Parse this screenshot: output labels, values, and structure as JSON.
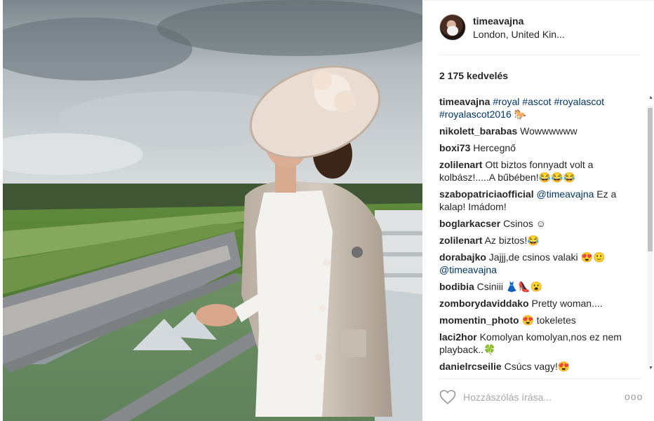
{
  "post": {
    "username": "timeavajna",
    "location": "London, United Kin...",
    "likes": "2 175 kedvelés",
    "add_comment_placeholder": "Hozzászólás írása...",
    "more_label": "ooo"
  },
  "caption": {
    "user": "timeavajna",
    "tags": [
      "#royal",
      "#ascot",
      "#royalascot",
      "#royalascot2016"
    ],
    "emoji": "🐎"
  },
  "comments": [
    {
      "user": "nikolett_barabas",
      "text": "Wowwwwww"
    },
    {
      "user": "boxi73",
      "text": "Hercegnő"
    },
    {
      "user": "zolilenart",
      "text": "Ott biztos fonnyadt volt a kolbász!.....A bűbében!😂😂😂"
    },
    {
      "user": "szabopatriciaofficial",
      "mention": "@timeavajna",
      "text": "Ez a kalap! Imádom!"
    },
    {
      "user": "boglarkacser",
      "text": "Csinos ☺"
    },
    {
      "user": "zolilenart",
      "text": "Az biztos!😂"
    },
    {
      "user": "dorabajko",
      "text": "Jajjj,de csinos valaki 😍🙂",
      "mention_after": "@timeavajna"
    },
    {
      "user": "bodibia",
      "text": "Csiniii 👗👠😮"
    },
    {
      "user": "zomborydaviddako",
      "text": "Pretty woman...."
    },
    {
      "user": "momentin_photo",
      "text": "😍 tokeletes"
    },
    {
      "user": "laci2hor",
      "text": "Komolyan komolyan,nos ez nem playback..🍀"
    },
    {
      "user": "danielrcseilie",
      "text": "Csúcs vagy!😍"
    }
  ],
  "icons": {
    "heart": "heart-icon",
    "more": "more-options-icon",
    "avatar": "avatar"
  },
  "colors": {
    "hashtag": "#003569",
    "text": "#262626",
    "muted": "#a8a8a8"
  }
}
